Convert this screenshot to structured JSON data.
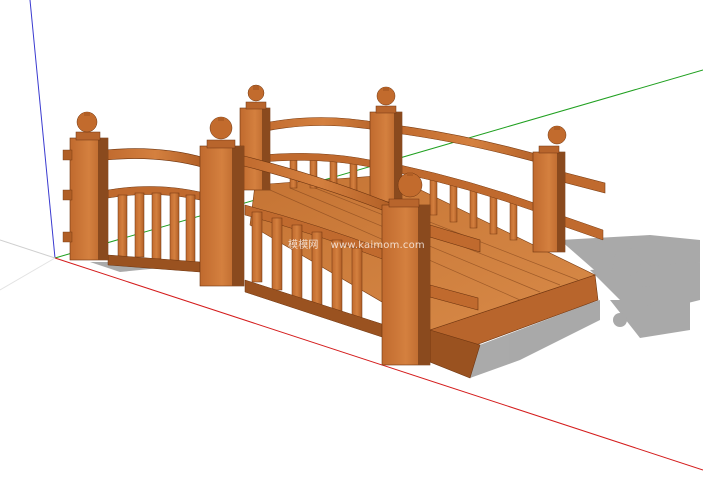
{
  "viewport": {
    "background": "#ffffff",
    "model_subject": "wooden-arched-bridge"
  },
  "axes": {
    "x_axis_color": "#d40000",
    "y_axis_color": "#16a016",
    "z_axis_color": "#3030c8"
  },
  "model": {
    "wood_color": "#b8652c",
    "wood_dark": "#8a4a1e",
    "wood_light": "#d07a3a",
    "shadow_color": "#9b9b9b"
  },
  "watermark": {
    "site_name": "模模网",
    "url": "www.kaimom.com"
  }
}
